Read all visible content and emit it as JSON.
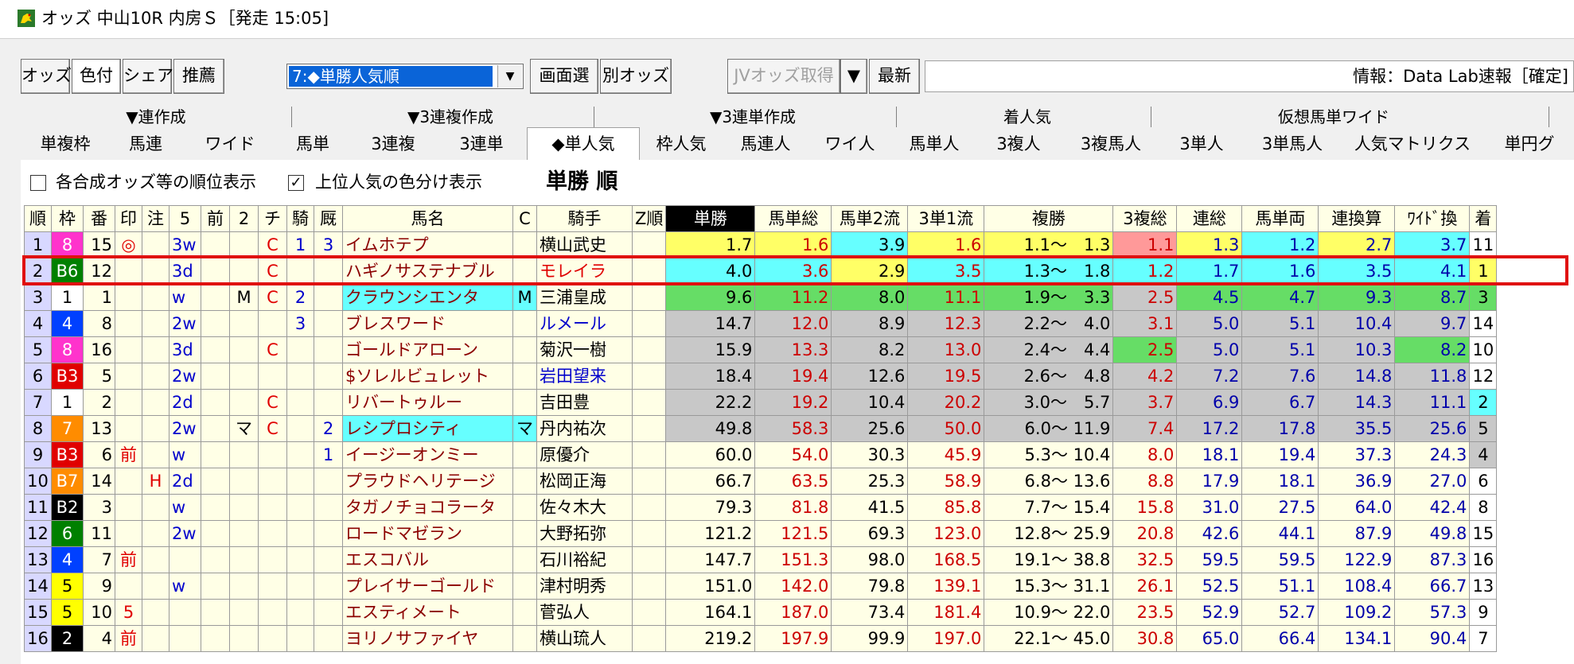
{
  "window": {
    "title": "オッズ 中山10R 内房Ｓ［発走 15:05]"
  },
  "toolbar": {
    "odds": "オッズ",
    "color": "色付",
    "share": "シェア",
    "recommend": "推薦",
    "view_select": "7:◆単勝人気順",
    "screen_select": "画面選",
    "other_odds": "別オッズ",
    "jv_odds": "JVオッズ取得",
    "refresh": "最新",
    "info": "情報：Data Lab速報［確定]"
  },
  "tabs": {
    "top": [
      "▼連作成",
      "▼3連複作成",
      "▼3連単作成",
      "着人気",
      "仮想馬単ワイド"
    ],
    "bottom": [
      "単複枠",
      "馬連",
      "ワイド",
      "馬単",
      "3連複",
      "3連単",
      "◆単人気",
      "枠人気",
      "馬連人",
      "ワイ人",
      "馬単人",
      "3複人",
      "3複馬人",
      "3単人",
      "3単馬人",
      "人気マトリクス",
      "単円グ"
    ]
  },
  "options": {
    "rank_display": "各合成オッズ等の順位表示",
    "color_top": "上位人気の色分け表示",
    "heading": "単勝 順"
  },
  "columns": [
    "順",
    "枠",
    "番",
    "印",
    "注",
    "5",
    "前",
    "2",
    "チ",
    "騎",
    "厩",
    "馬名",
    "C",
    "騎手",
    "Z順",
    "単勝",
    "馬単総",
    "馬単2流",
    "3単1流",
    "複勝",
    "3複総",
    "連総",
    "馬単両",
    "連換算",
    "ﾜｲﾄﾞ換",
    "着"
  ],
  "colors": {
    "hl_border": "#e01010",
    "yellow": "#ffff66",
    "pink": "#ff9999",
    "cyan": "#66ffff",
    "green": "#66dd66",
    "gray": "#c8c8c8"
  },
  "rows": [
    {
      "rank": "1",
      "waku": "8",
      "num": "15",
      "mark": "◎",
      "note": "",
      "f5": "3w",
      "mae": "",
      "f2": "",
      "chi": "C",
      "ki": "1",
      "kyu": "3",
      "name": "イムホテプ",
      "c": "",
      "jockey": "横山武史",
      "z": "",
      "tan": "1.7",
      "bt": "1.6",
      "b2": "3.9",
      "s1": "1.6",
      "fuku": "1.1～　1.3",
      "f3": "1.1",
      "rs": "1.3",
      "br": "1.2",
      "rk": "2.7",
      "wk": "3.7",
      "chaku": "11"
    },
    {
      "rank": "2",
      "waku": "B6",
      "num": "12",
      "mark": "",
      "note": "",
      "f5": "3d",
      "mae": "",
      "f2": "",
      "chi": "C",
      "ki": "",
      "kyu": "",
      "name": "ハギノサステナブル",
      "c": "",
      "jockey": "モレイラ",
      "z": "",
      "tan": "4.0",
      "bt": "3.6",
      "b2": "2.9",
      "s1": "3.5",
      "fuku": "1.3～　1.8",
      "f3": "1.2",
      "rs": "1.7",
      "br": "1.6",
      "rk": "3.5",
      "wk": "4.1",
      "chaku": "1"
    },
    {
      "rank": "3",
      "waku": "1",
      "num": "1",
      "mark": "",
      "note": "",
      "f5": "w",
      "mae": "",
      "f2": "M",
      "chi": "C",
      "ki": "2",
      "kyu": "",
      "name": "クラウンシエンタ",
      "c": "M",
      "jockey": "三浦皇成",
      "z": "",
      "tan": "9.6",
      "bt": "11.2",
      "b2": "8.0",
      "s1": "11.1",
      "fuku": "1.9～　3.3",
      "f3": "2.5",
      "rs": "4.5",
      "br": "4.7",
      "rk": "9.3",
      "wk": "8.7",
      "chaku": "3"
    },
    {
      "rank": "4",
      "waku": "4",
      "num": "8",
      "mark": "",
      "note": "",
      "f5": "2w",
      "mae": "",
      "f2": "",
      "chi": "",
      "ki": "3",
      "kyu": "",
      "name": "ブレスワード",
      "c": "",
      "jockey": "ルメール",
      "z": "",
      "tan": "14.7",
      "bt": "12.0",
      "b2": "8.9",
      "s1": "12.3",
      "fuku": "2.2～　4.0",
      "f3": "3.1",
      "rs": "5.0",
      "br": "5.1",
      "rk": "10.4",
      "wk": "9.7",
      "chaku": "14"
    },
    {
      "rank": "5",
      "waku": "8",
      "num": "16",
      "mark": "",
      "note": "",
      "f5": "3d",
      "mae": "",
      "f2": "",
      "chi": "C",
      "ki": "",
      "kyu": "",
      "name": "ゴールドアローン",
      "c": "",
      "jockey": "菊沢一樹",
      "z": "",
      "tan": "15.9",
      "bt": "13.3",
      "b2": "8.2",
      "s1": "13.0",
      "fuku": "2.4～　4.4",
      "f3": "2.5",
      "rs": "5.0",
      "br": "5.1",
      "rk": "10.3",
      "wk": "8.2",
      "chaku": "10"
    },
    {
      "rank": "6",
      "waku": "B3",
      "num": "5",
      "mark": "",
      "note": "",
      "f5": "2w",
      "mae": "",
      "f2": "",
      "chi": "",
      "ki": "",
      "kyu": "",
      "name": "$ソレルビュレット",
      "c": "",
      "jockey": "岩田望来",
      "z": "",
      "tan": "18.4",
      "bt": "19.4",
      "b2": "12.6",
      "s1": "19.5",
      "fuku": "2.6～　4.8",
      "f3": "4.2",
      "rs": "7.2",
      "br": "7.6",
      "rk": "14.8",
      "wk": "11.8",
      "chaku": "12"
    },
    {
      "rank": "7",
      "waku": "1",
      "num": "2",
      "mark": "",
      "note": "",
      "f5": "2d",
      "mae": "",
      "f2": "",
      "chi": "C",
      "ki": "",
      "kyu": "",
      "name": "リバートゥルー",
      "c": "",
      "jockey": "吉田豊",
      "z": "",
      "tan": "22.2",
      "bt": "19.2",
      "b2": "10.4",
      "s1": "20.2",
      "fuku": "3.0～　5.7",
      "f3": "3.7",
      "rs": "6.9",
      "br": "6.7",
      "rk": "14.3",
      "wk": "11.1",
      "chaku": "2"
    },
    {
      "rank": "8",
      "waku": "7",
      "num": "13",
      "mark": "",
      "note": "",
      "f5": "2w",
      "mae": "",
      "f2": "マ",
      "chi": "C",
      "ki": "",
      "kyu": "2",
      "name": "レシプロシティ",
      "c": "マ",
      "jockey": "丹内祐次",
      "z": "",
      "tan": "49.8",
      "bt": "58.3",
      "b2": "25.6",
      "s1": "50.0",
      "fuku": "6.0～ 11.9",
      "f3": "7.4",
      "rs": "17.2",
      "br": "17.8",
      "rk": "35.5",
      "wk": "25.6",
      "chaku": "5"
    },
    {
      "rank": "9",
      "waku": "B3",
      "num": "6",
      "mark": "前",
      "note": "",
      "f5": "w",
      "mae": "",
      "f2": "",
      "chi": "",
      "ki": "",
      "kyu": "1",
      "name": "イージーオンミー",
      "c": "",
      "jockey": "原優介",
      "z": "",
      "tan": "60.0",
      "bt": "54.0",
      "b2": "30.3",
      "s1": "45.9",
      "fuku": "5.3～ 10.4",
      "f3": "8.0",
      "rs": "18.1",
      "br": "19.4",
      "rk": "37.3",
      "wk": "24.3",
      "chaku": "4"
    },
    {
      "rank": "10",
      "waku": "B7",
      "num": "14",
      "mark": "",
      "note": "H",
      "f5": "2d",
      "mae": "",
      "f2": "",
      "chi": "",
      "ki": "",
      "kyu": "",
      "name": "プラウドヘリテージ",
      "c": "",
      "jockey": "松岡正海",
      "z": "",
      "tan": "66.7",
      "bt": "63.5",
      "b2": "25.3",
      "s1": "58.9",
      "fuku": "6.8～ 13.6",
      "f3": "8.8",
      "rs": "17.9",
      "br": "18.1",
      "rk": "36.9",
      "wk": "27.0",
      "chaku": "6"
    },
    {
      "rank": "11",
      "waku": "B2",
      "num": "3",
      "mark": "",
      "note": "",
      "f5": "w",
      "mae": "",
      "f2": "",
      "chi": "",
      "ki": "",
      "kyu": "",
      "name": "タガノチョコラータ",
      "c": "",
      "jockey": "佐々木大",
      "z": "",
      "tan": "79.3",
      "bt": "81.8",
      "b2": "41.5",
      "s1": "85.8",
      "fuku": "7.7～ 15.4",
      "f3": "15.8",
      "rs": "31.0",
      "br": "27.5",
      "rk": "64.0",
      "wk": "42.4",
      "chaku": "8"
    },
    {
      "rank": "12",
      "waku": "6",
      "num": "11",
      "mark": "",
      "note": "",
      "f5": "2w",
      "mae": "",
      "f2": "",
      "chi": "",
      "ki": "",
      "kyu": "",
      "name": "ロードマゼラン",
      "c": "",
      "jockey": "大野拓弥",
      "z": "",
      "tan": "121.2",
      "bt": "121.5",
      "b2": "69.3",
      "s1": "123.0",
      "fuku": "12.8～ 25.9",
      "f3": "20.8",
      "rs": "42.6",
      "br": "44.1",
      "rk": "87.9",
      "wk": "49.8",
      "chaku": "15"
    },
    {
      "rank": "13",
      "waku": "4",
      "num": "7",
      "mark": "前",
      "note": "",
      "f5": "",
      "mae": "",
      "f2": "",
      "chi": "",
      "ki": "",
      "kyu": "",
      "name": "エスコバル",
      "c": "",
      "jockey": "石川裕紀",
      "z": "",
      "tan": "147.7",
      "bt": "151.3",
      "b2": "98.0",
      "s1": "168.5",
      "fuku": "19.1～ 38.8",
      "f3": "32.5",
      "rs": "59.5",
      "br": "59.5",
      "rk": "122.9",
      "wk": "87.3",
      "chaku": "16"
    },
    {
      "rank": "14",
      "waku": "5",
      "num": "9",
      "mark": "",
      "note": "",
      "f5": "w",
      "mae": "",
      "f2": "",
      "chi": "",
      "ki": "",
      "kyu": "",
      "name": "プレイサーゴールド",
      "c": "",
      "jockey": "津村明秀",
      "z": "",
      "tan": "151.0",
      "bt": "142.0",
      "b2": "79.8",
      "s1": "139.1",
      "fuku": "15.3～ 31.1",
      "f3": "26.1",
      "rs": "52.5",
      "br": "51.1",
      "rk": "108.4",
      "wk": "66.7",
      "chaku": "13"
    },
    {
      "rank": "15",
      "waku": "5",
      "num": "10",
      "mark": "5",
      "note": "",
      "f5": "",
      "mae": "",
      "f2": "",
      "chi": "",
      "ki": "",
      "kyu": "",
      "name": "エスティメート",
      "c": "",
      "jockey": "菅弘人",
      "z": "",
      "tan": "164.1",
      "bt": "187.0",
      "b2": "73.4",
      "s1": "181.4",
      "fuku": "10.9～ 22.0",
      "f3": "23.5",
      "rs": "52.9",
      "br": "52.7",
      "rk": "109.2",
      "wk": "57.3",
      "chaku": "9"
    },
    {
      "rank": "16",
      "waku": "2",
      "num": "4",
      "mark": "前",
      "note": "",
      "f5": "",
      "mae": "",
      "f2": "",
      "chi": "",
      "ki": "",
      "kyu": "",
      "name": "ヨリノサファイヤ",
      "c": "",
      "jockey": "横山琉人",
      "z": "",
      "tan": "219.2",
      "bt": "197.9",
      "b2": "99.9",
      "s1": "197.0",
      "fuku": "22.1～ 45.0",
      "f3": "30.8",
      "rs": "65.0",
      "br": "66.4",
      "rk": "134.1",
      "wk": "90.4",
      "chaku": "7"
    }
  ]
}
